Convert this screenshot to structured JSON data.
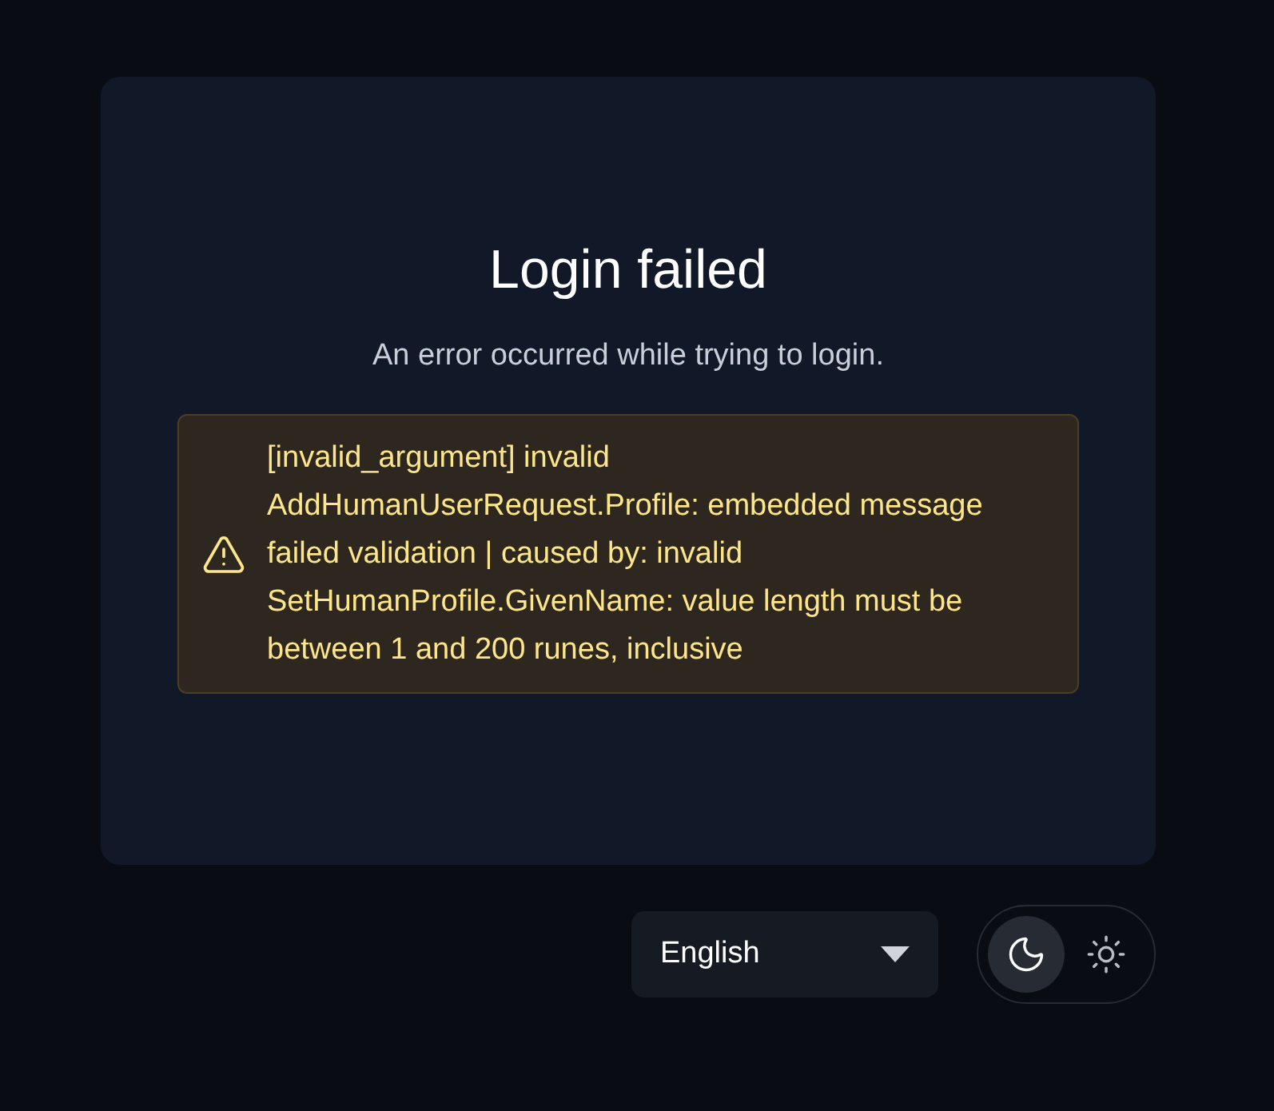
{
  "card": {
    "title": "Login failed",
    "description": "An error occurred while trying to login.",
    "error": {
      "message": "[invalid_argument] invalid AddHumanUserRequest.Profile: embedded message failed validation | caused by: invalid SetHumanProfile.GivenName: value length must be between 1 and 200 runes, inclusive"
    }
  },
  "language": {
    "value": "English"
  },
  "theme_toggle": [
    {
      "kind": "dark",
      "selected": true
    },
    {
      "kind": "light",
      "selected": false
    }
  ]
}
